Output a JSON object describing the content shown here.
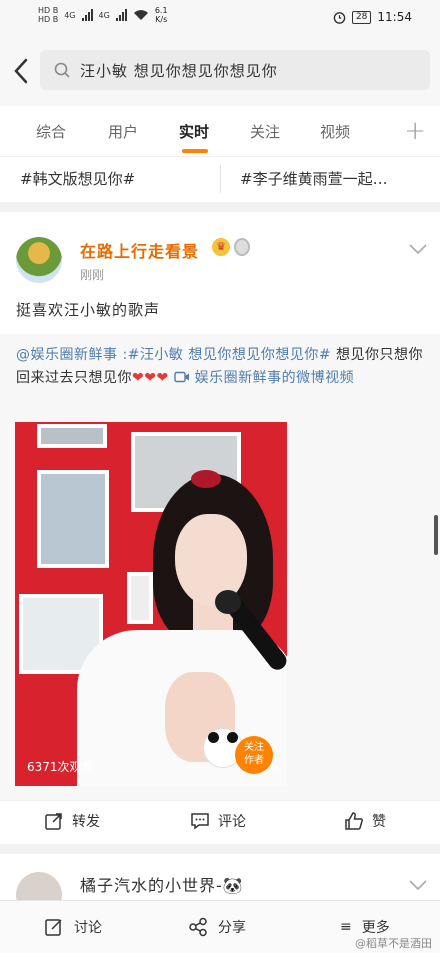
{
  "status_bar": {
    "sim1": "HD B",
    "sim2": "HD B",
    "net1": "4G",
    "net2": "4G",
    "speed_value": "6.1",
    "speed_unit": "K/s",
    "battery": "28",
    "time": "11:54"
  },
  "search": {
    "query": "汪小敏 想见你想见你想见你"
  },
  "tabs": [
    {
      "label": "综合",
      "active": false
    },
    {
      "label": "用户",
      "active": false
    },
    {
      "label": "实时",
      "active": true
    },
    {
      "label": "关注",
      "active": false
    },
    {
      "label": "视频",
      "active": false
    }
  ],
  "hashtags": [
    "#韩文版想见你#",
    "#李子维黄雨萱一起…"
  ],
  "post": {
    "author": "在路上行走看景",
    "time": "刚刚",
    "text": "挺喜欢汪小敏的歌声",
    "repost": {
      "mention": "@娱乐圈新鲜事",
      "separator": " :",
      "topic": "#汪小敏 想见你想见你想见你#",
      "body": " 想见你只想你回来过去只想见你",
      "hearts": "❤❤❤",
      "video_link": " 娱乐圈新鲜事的微博视频"
    },
    "video": {
      "view_count": "6371次观看",
      "follow_line1": "关注",
      "follow_line2": "作者",
      "follow_suffix": ".6"
    },
    "actions": {
      "repost": "转发",
      "comment": "评论",
      "like": "赞"
    }
  },
  "next_post": {
    "author": "橘子汽水的小世界-🐼"
  },
  "bottom_bar": {
    "discuss": "讨论",
    "share": "分享",
    "more": "更多",
    "watermark": "@稻草不是酒田"
  },
  "colors": {
    "accent": "#ff8200",
    "author": "#e86b00",
    "link": "#507daf",
    "video_bg": "#d8232f"
  }
}
